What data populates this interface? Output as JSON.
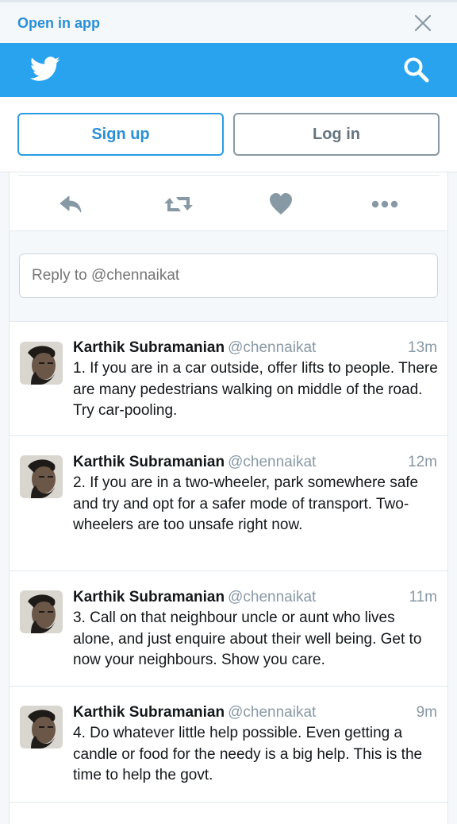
{
  "banner": {
    "open_in_app": "Open in app"
  },
  "header": {
    "logo_icon": "twitter-bird-icon",
    "search_icon": "search-icon"
  },
  "auth": {
    "signup_label": "Sign up",
    "login_label": "Log in"
  },
  "actions": [
    "reply-icon",
    "retweet-icon",
    "heart-icon",
    "more-icon"
  ],
  "reply": {
    "placeholder": "Reply to @chennaikat"
  },
  "tweets": [
    {
      "name": "Karthik Subramanian",
      "handle": "@chennaikat",
      "time": "13m",
      "text": "1. If you are in a car outside, offer lifts to people. There are many pedestrians walking on middle of the road. Try car-pooling."
    },
    {
      "name": "Karthik Subramanian",
      "handle": "@chennaikat",
      "time": "12m",
      "text": "2. If you are in a two-wheeler, park somewhere safe and try and opt for a safer mode of transport. Two-wheelers are too unsafe right now."
    },
    {
      "name": "Karthik Subramanian",
      "handle": "@chennaikat",
      "time": "11m",
      "text": "3. Call on that neighbour uncle or aunt who lives alone, and just enquire about their well being. Get to now your neighbours. Show you care."
    },
    {
      "name": "Karthik Subramanian",
      "handle": "@chennaikat",
      "time": "9m",
      "text": "4. Do whatever little help possible. Even getting a candle or food for the needy is a big help. This is the time to help the govt."
    }
  ],
  "colors": {
    "brand": "#2aa3ef",
    "link": "#2b8fd6",
    "muted": "#8899a6",
    "text": "#14171a"
  }
}
